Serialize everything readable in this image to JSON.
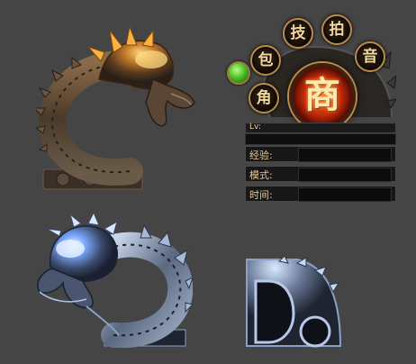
{
  "hud": {
    "orbs": {
      "skill": "技",
      "auction": "拍",
      "bag": "包",
      "sound": "音",
      "character": "角",
      "shop": "商"
    },
    "level_label": "Lv:",
    "stats": [
      {
        "label": "经验:",
        "value": ""
      },
      {
        "label": "模式:",
        "value": ""
      },
      {
        "label": "时间:",
        "value": ""
      }
    ]
  },
  "art": {
    "gold_dragon": "gold-dragon-ring-icon",
    "blue_dragon": "silver-blue-dragon-ring-icon",
    "corner_dragon": "corner-dragon-frame-icon"
  },
  "colors": {
    "background": "#454545",
    "gold_accent": "#e8a040",
    "shop_orb": "#d03010",
    "blue_glow": "#8ab8ff"
  }
}
